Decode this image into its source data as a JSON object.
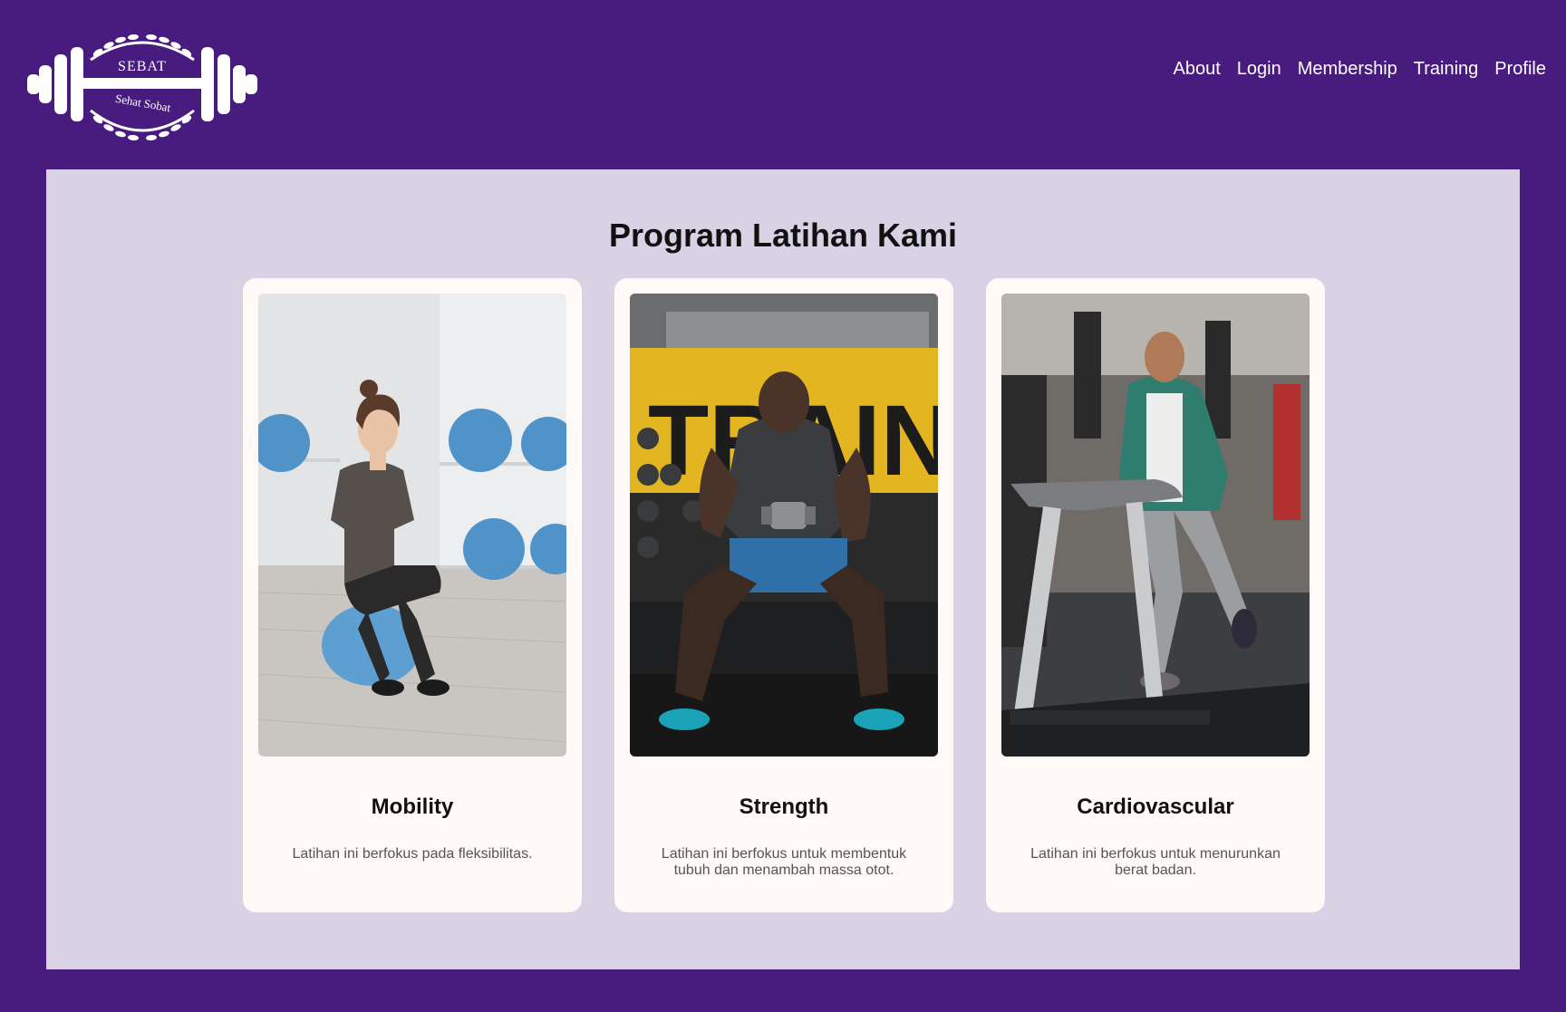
{
  "logo": {
    "top_text": "SEBAT",
    "bottom_text": "Sehat Sobat"
  },
  "nav": {
    "items": [
      "About",
      "Login",
      "Membership",
      "Training",
      "Profile"
    ]
  },
  "section": {
    "title": "Program Latihan Kami"
  },
  "cards": [
    {
      "title": "Mobility",
      "description": "Latihan ini berfokus pada fleksibilitas."
    },
    {
      "title": "Strength",
      "description": "Latihan ini berfokus untuk membentuk tubuh dan menambah massa otot."
    },
    {
      "title": "Cardiovascular",
      "description": "Latihan ini berfokus untuk menurunkan berat badan."
    }
  ],
  "colors": {
    "header_bg": "#481b7f",
    "panel_bg": "#d9d2e5",
    "card_bg": "#fff9f8",
    "nav_text": "#ffffff"
  }
}
